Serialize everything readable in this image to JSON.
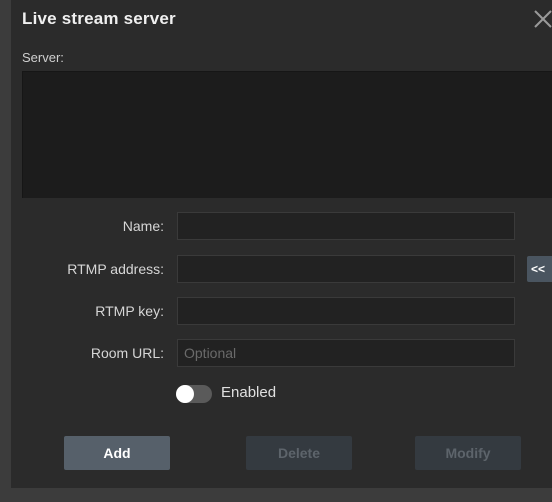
{
  "dialog": {
    "title": "Live stream server",
    "close_icon": "close-icon"
  },
  "server": {
    "label": "Server:",
    "items": []
  },
  "form": {
    "name_label": "Name:",
    "name_value": "",
    "rtmp_address_label": "RTMP address:",
    "rtmp_address_value": "",
    "rtmp_key_label": "RTMP key:",
    "rtmp_key_value": "",
    "room_url_label": "Room URL:",
    "room_url_value": "",
    "room_url_placeholder": "Optional",
    "arrow_button_label": "<<"
  },
  "enabled": {
    "label": "Enabled",
    "on": false
  },
  "buttons": {
    "add": "Add",
    "delete": "Delete",
    "modify": "Modify"
  },
  "colors": {
    "background": "#2b2b2b",
    "list_background": "#1c1c1c",
    "primary_button": "#56606a",
    "disabled_button": "#343a40"
  }
}
